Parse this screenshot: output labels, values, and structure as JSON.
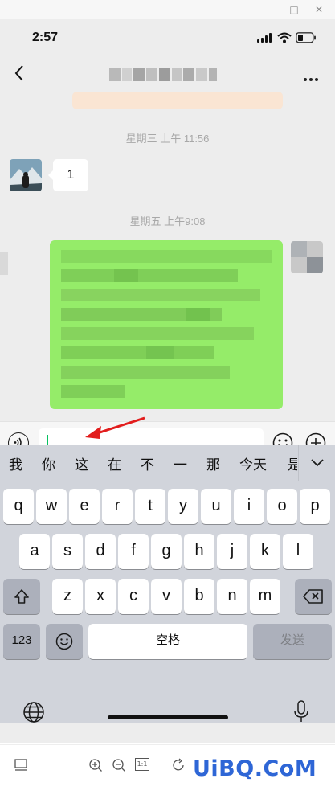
{
  "window_controls": {
    "minimize": "–",
    "maximize": "□",
    "close": "✕"
  },
  "status_bar": {
    "time": "2:57"
  },
  "chat": {
    "timestamps": [
      "星期三 上午 11:56",
      "星期五 上午9:08"
    ],
    "left_message": "1"
  },
  "input": {
    "value": "",
    "placeholder": ""
  },
  "keyboard": {
    "candidates": [
      "我",
      "你",
      "这",
      "在",
      "不",
      "一",
      "那",
      "今天",
      "是"
    ],
    "row1": [
      "q",
      "w",
      "e",
      "r",
      "t",
      "y",
      "u",
      "i",
      "o",
      "p"
    ],
    "row2": [
      "a",
      "s",
      "d",
      "f",
      "g",
      "h",
      "j",
      "k",
      "l"
    ],
    "row3": [
      "z",
      "x",
      "c",
      "v",
      "b",
      "n",
      "m"
    ],
    "num_key": "123",
    "space_key": "空格",
    "send_key": "发送"
  },
  "viewer_toolbar": {
    "one_to_one": "1:1"
  },
  "watermark": "UiBQ.CoM",
  "colors": {
    "sent_bubble": "#95ec69",
    "cursor": "#07c160",
    "keyboard_bg": "#d1d4db"
  }
}
